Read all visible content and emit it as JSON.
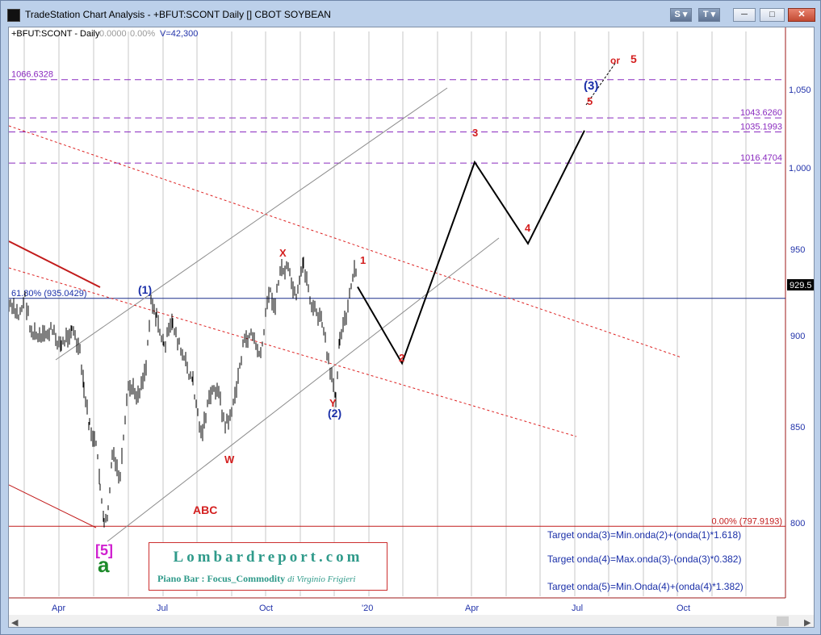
{
  "window": {
    "title": "TradeStation Chart Analysis - +BFUT:SCONT Daily [] CBOT SOYBEAN",
    "buttons": [
      "S",
      "T"
    ]
  },
  "chart_data": {
    "type": "line",
    "title": "",
    "header": {
      "symbol": "+BFUT:SCONT - Daily",
      "change": "0.0000",
      "pct": "0.00%",
      "volume": "V=42,300"
    },
    "y_axis": {
      "ticks": [
        800,
        850,
        900,
        950,
        "1,000",
        "1,050"
      ],
      "ylim": [
        770,
        1090
      ],
      "position": "right"
    },
    "x_axis": {
      "ticks": [
        "Apr",
        "Jul",
        "Oct",
        "'20",
        "Apr",
        "Jul",
        "Oct"
      ]
    },
    "last_price": "929.5",
    "projection_path": {
      "labels": [
        "1",
        "2",
        "3",
        "4",
        "5"
      ],
      "values": [
        942,
        896,
        1017,
        968,
        1036
      ]
    },
    "levels": [
      {
        "label": "1066.6328",
        "value": 1066.6328
      },
      {
        "label": "1043.6260",
        "value": 1043.626
      },
      {
        "label": "1035.1993",
        "value": 1035.1993
      },
      {
        "label": "1016.4704",
        "value": 1016.4704
      },
      {
        "label": "61.80% (935.0429)",
        "value": 935.0429
      },
      {
        "label": "0.00% (797.9193)",
        "value": 797.9193
      }
    ],
    "wave_labels": [
      "(1)",
      "X",
      "W",
      "Y",
      "(2)",
      "(3)",
      "or",
      "ABC",
      "[5]",
      "a"
    ],
    "targets": [
      "Target onda(3)=Min.onda(2)+(onda(1)*1.618)",
      "Target onda(4)=Max.onda(3)-(onda(3)*0.382)",
      "Target onda(5)=Min.Onda(4)+(onda(4)*1.382)"
    ]
  },
  "logo": {
    "title": "Lombardreport.com",
    "subtitle_bold": "Piano Bar : Focus_Commodity",
    "subtitle_italic": "di Virginio Frigieri"
  },
  "colors": {
    "level": "#8a2bbf",
    "wave_red": "#d41f1f",
    "wave_blue": "#1a2fa8",
    "magenta": "#d020d0",
    "green": "#1d8a2a",
    "logo": "#2f9a8a"
  }
}
